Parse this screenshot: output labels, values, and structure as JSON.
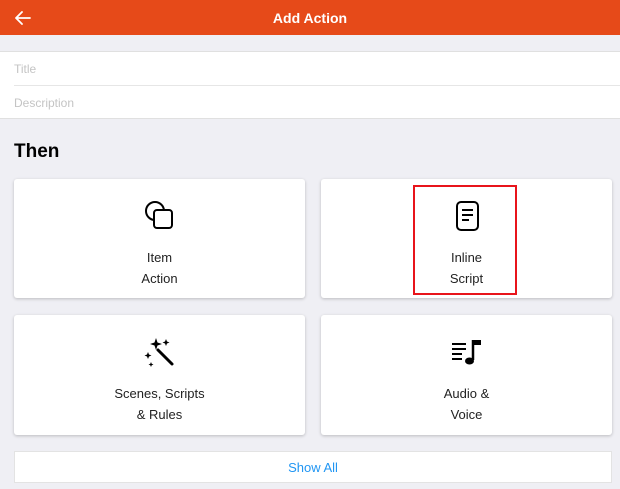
{
  "header": {
    "title": "Add Action",
    "back_icon": "arrow-left-icon",
    "background": "#e64a19"
  },
  "form": {
    "title_placeholder": "Title",
    "description_placeholder": "Description"
  },
  "section": {
    "title": "Then"
  },
  "cards": [
    {
      "icon": "item-action-icon",
      "line1": "Item",
      "line2": "Action"
    },
    {
      "icon": "inline-script-icon",
      "line1": "Inline",
      "line2": "Script",
      "highlighted": true
    },
    {
      "icon": "magic-wand-icon",
      "line1": "Scenes, Scripts",
      "line2": "& Rules"
    },
    {
      "icon": "audio-voice-icon",
      "line1": "Audio &",
      "line2": "Voice"
    }
  ],
  "footer": {
    "show_all_label": "Show All",
    "link_color": "#2196f3"
  },
  "highlight_color": "#e8141b"
}
